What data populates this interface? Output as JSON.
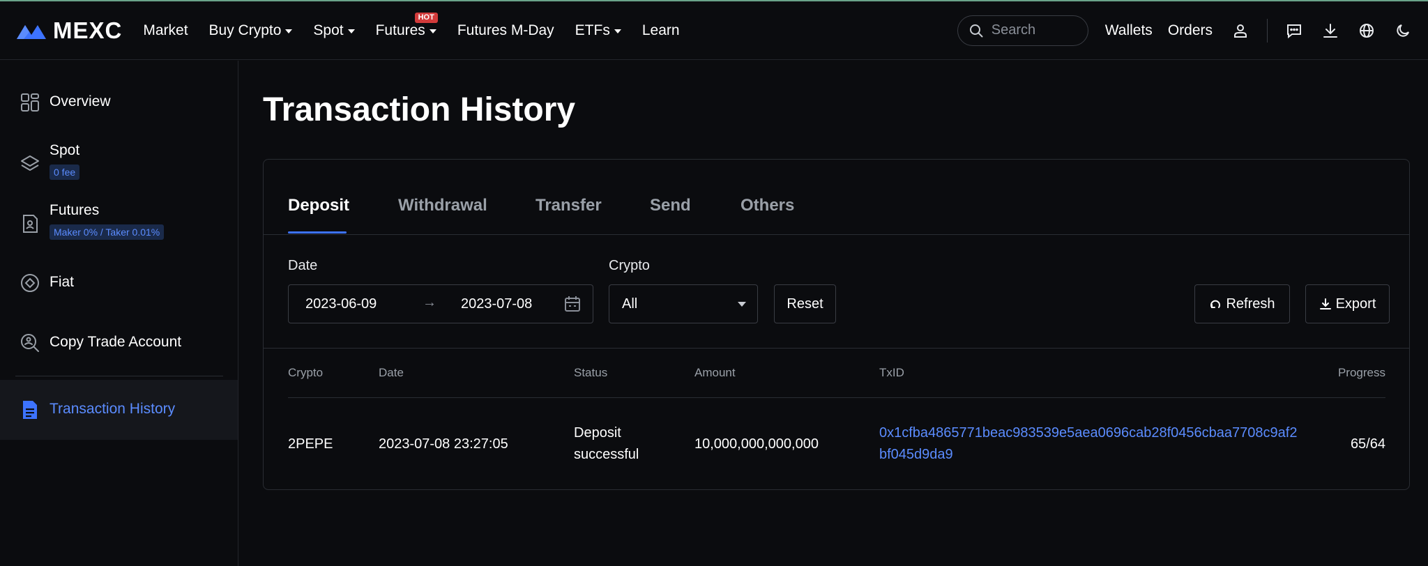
{
  "brand": {
    "name": "MEXC",
    "accent": "#3d73ff"
  },
  "nav": {
    "items": [
      {
        "label": "Market",
        "dropdown": false
      },
      {
        "label": "Buy Crypto",
        "dropdown": true
      },
      {
        "label": "Spot",
        "dropdown": true
      },
      {
        "label": "Futures",
        "dropdown": true,
        "badge": "HOT"
      },
      {
        "label": "Futures M-Day",
        "dropdown": false
      },
      {
        "label": "ETFs",
        "dropdown": true
      },
      {
        "label": "Learn",
        "dropdown": false
      }
    ],
    "search_placeholder": "Search",
    "wallets": "Wallets",
    "orders": "Orders",
    "icons": [
      "user-icon",
      "chat-icon",
      "download-icon",
      "globe-icon",
      "moon-icon"
    ]
  },
  "sidebar": {
    "items": [
      {
        "label": "Overview",
        "icon": "grid-icon"
      },
      {
        "label": "Spot",
        "icon": "layers-icon",
        "tag": "0 fee"
      },
      {
        "label": "Futures",
        "icon": "contract-icon",
        "tag": "Maker 0% / Taker 0.01%"
      },
      {
        "label": "Fiat",
        "icon": "fiat-icon"
      },
      {
        "label": "Copy Trade Account",
        "icon": "copy-trade-icon"
      },
      {
        "label": "Transaction History",
        "icon": "document-icon",
        "active": true
      }
    ]
  },
  "page": {
    "title": "Transaction History"
  },
  "tabs": [
    "Deposit",
    "Withdrawal",
    "Transfer",
    "Send",
    "Others"
  ],
  "filters": {
    "date_label": "Date",
    "date_from": "2023-06-09",
    "date_arrow": "→",
    "date_to": "2023-07-08",
    "crypto_label": "Crypto",
    "crypto_value": "All",
    "reset": "Reset",
    "refresh": "Refresh",
    "export": "Export"
  },
  "table": {
    "headers": [
      "Crypto",
      "Date",
      "Status",
      "Amount",
      "TxID",
      "Progress"
    ],
    "rows": [
      {
        "crypto": "2PEPE",
        "date": "2023-07-08 23:27:05",
        "status_line1": "Deposit",
        "status_line2": "successful",
        "amount": "10,000,000,000,000",
        "txid": "0x1cfba4865771beac983539e5aea0696cab28f0456cbaa7708c9af2bf045d9da9",
        "progress": "65/64"
      }
    ]
  }
}
